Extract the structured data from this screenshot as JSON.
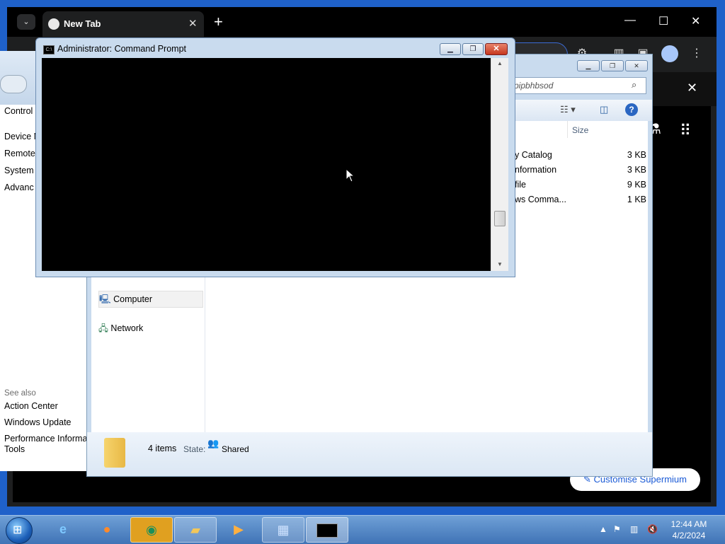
{
  "browser": {
    "tab_title": "New Tab",
    "new_tab_glyph": "+",
    "customise_label": "Customise Supermium"
  },
  "control_panel": {
    "links": [
      "Control",
      "Device M",
      "Remote",
      "System p",
      "Advanc"
    ],
    "see_also": "See also",
    "see_also_links": [
      "Action Center",
      "Windows Update",
      "Performance Informat",
      "Tools"
    ]
  },
  "explorer": {
    "search_text": "pipbhbsod",
    "column_size": "Size",
    "rows": [
      {
        "name": "y Catalog",
        "size": "3 KB"
      },
      {
        "name": "nformation",
        "size": "3 KB"
      },
      {
        "name": "file",
        "size": "9 KB"
      },
      {
        "name": "ws Comma...",
        "size": "1 KB"
      }
    ],
    "nav": {
      "computer": "Computer",
      "network": "Network"
    },
    "details": {
      "count": "4 items",
      "state_label": "State:",
      "state_value": "Shared"
    }
  },
  "cmd": {
    "title": "Administrator:  Command Prompt",
    "icon_text": "C:\\"
  },
  "taskbar": {
    "time": "12:44 AM",
    "date": "4/2/2024"
  },
  "colors": {
    "desktop": "#1f61c9",
    "console_bg": "#000000",
    "accent": "#1a5ad6"
  }
}
